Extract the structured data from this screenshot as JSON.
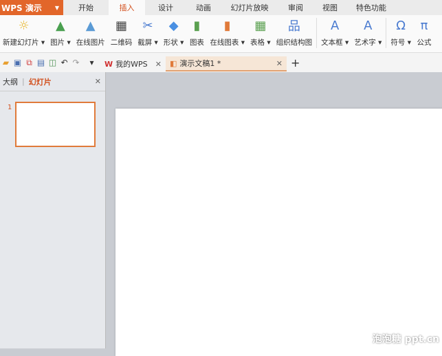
{
  "app": {
    "name": "WPS 演示"
  },
  "menu_tabs": [
    "开始",
    "插入",
    "设计",
    "动画",
    "幻灯片放映",
    "审阅",
    "视图",
    "特色功能"
  ],
  "active_tab": "插入",
  "ribbon": [
    {
      "label": "新建幻灯片 ▾",
      "icon": "new-slide-icon",
      "glyph": "☼",
      "color": "#e8b830"
    },
    {
      "label": "图片 ▾",
      "icon": "picture-icon",
      "glyph": "▲",
      "color": "#4aa050"
    },
    {
      "label": "在线图片",
      "icon": "online-picture-icon",
      "glyph": "▲",
      "color": "#5b9bd5"
    },
    {
      "label": "二维码",
      "icon": "qrcode-icon",
      "glyph": "▦",
      "color": "#444"
    },
    {
      "label": "截屏 ▾",
      "icon": "screenshot-icon",
      "glyph": "✂",
      "color": "#4a7bd0"
    },
    {
      "label": "形状 ▾",
      "icon": "shape-icon",
      "glyph": "◆",
      "color": "#4a90e2"
    },
    {
      "label": "图表",
      "icon": "chart-icon",
      "glyph": "▮",
      "color": "#5aa050"
    },
    {
      "label": "在线图表 ▾",
      "icon": "online-chart-icon",
      "glyph": "▮",
      "color": "#e07a3a"
    },
    {
      "label": "表格 ▾",
      "icon": "table-icon",
      "glyph": "▦",
      "color": "#5aa050"
    },
    {
      "label": "组织结构图",
      "icon": "org-chart-icon",
      "glyph": "品",
      "color": "#4a7bd0"
    },
    {
      "label": "文本框 ▾",
      "icon": "textbox-icon",
      "glyph": "A",
      "color": "#4a7bd0"
    },
    {
      "label": "艺术字 ▾",
      "icon": "wordart-icon",
      "glyph": "A",
      "color": "#4a7bd0"
    },
    {
      "label": "符号 ▾",
      "icon": "symbol-icon",
      "glyph": "Ω",
      "color": "#4a7bd0"
    },
    {
      "label": "公式",
      "icon": "formula-icon",
      "glyph": "π",
      "color": "#4a7bd0"
    }
  ],
  "doc_tabs": [
    {
      "label": "我的WPS",
      "icon": "W"
    },
    {
      "label": "演示文稿1 *",
      "icon": "P"
    }
  ],
  "panel": {
    "outline": "大纲",
    "slides": "幻灯片",
    "slide_number": "1"
  },
  "watermark": "泡泡糖 ppt.cn"
}
